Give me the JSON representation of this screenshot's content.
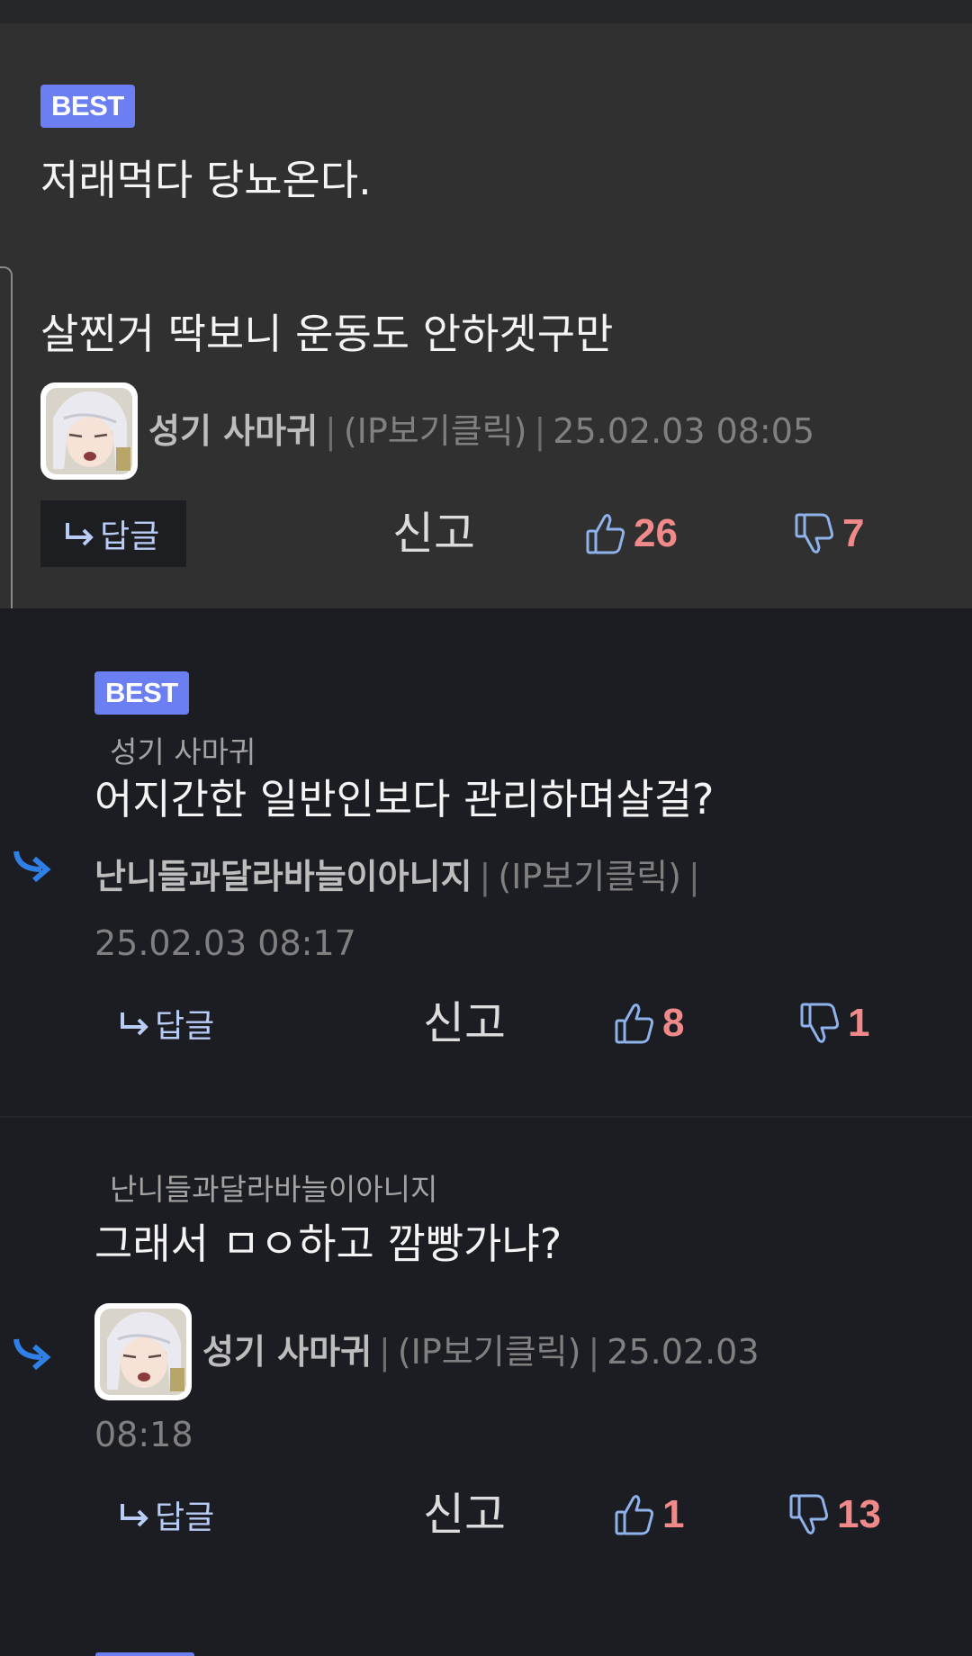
{
  "comments": [
    {
      "badge": "BEST",
      "text_line1": "저래먹다 당뇨온다.",
      "text_line2": "살찐거 딱보니 운동도 안하겟구만",
      "nickname": "성기 사마귀",
      "separator": "|",
      "ip_label": "(IP보기클릭)",
      "date": "25.02.03 08:05",
      "reply_label": "답글",
      "report_label": "신고",
      "likes": "26",
      "dislikes": "7"
    },
    {
      "badge": "BEST",
      "reply_to": "성기 사마귀",
      "text": "어지간한 일반인보다 관리하며살걸?",
      "nickname": "난니들과달라바늘이아니지",
      "separator": "|",
      "ip_label": "(IP보기클릭)",
      "date": "25.02.03 08:17",
      "reply_label": "답글",
      "report_label": "신고",
      "likes": "8",
      "dislikes": "1"
    },
    {
      "reply_to": "난니들과달라바늘이아니지",
      "text": "그래서 ㅁㅇ하고 깜빵가냐?",
      "nickname": "성기 사마귀",
      "separator": "|",
      "ip_label": "(IP보기클릭)",
      "date_part1": "25.02.03",
      "date_part2": "08:18",
      "reply_label": "답글",
      "report_label": "신고",
      "likes": "1",
      "dislikes": "13"
    }
  ],
  "icons": {
    "reply": "reply-arrow-icon",
    "like": "thumbs-up-icon",
    "dislike": "thumbs-down-icon",
    "thread": "reply-thread-arrow-icon",
    "avatar": "anime-character-avatar"
  },
  "colors": {
    "badge": "#6c7ff2",
    "count": "#f08a8a",
    "reply": "#b9ccf5",
    "thread_arrow": "#2f7fe6"
  }
}
